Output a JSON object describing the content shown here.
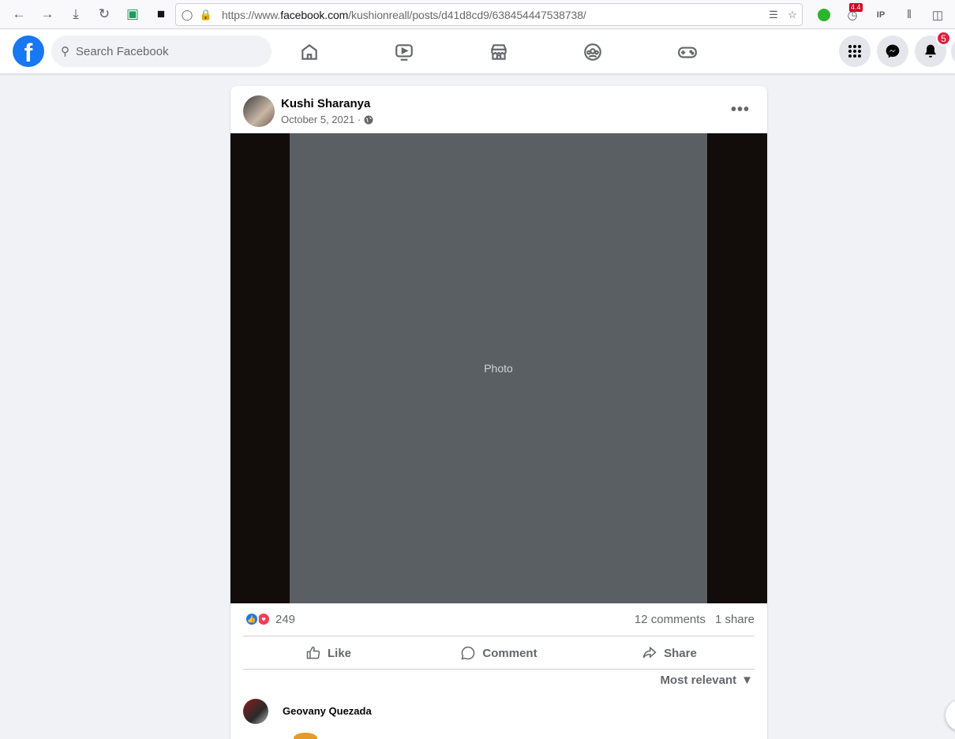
{
  "browser": {
    "url_prefix": "https://www.",
    "url_domain": "facebook.com",
    "url_path": "/kushionreall/posts/d41d8cd9/638454447538738/",
    "ext_badge": "4.4",
    "icons": [
      "back-icon",
      "forward-icon",
      "download-icon",
      "reload-icon",
      "extension-icon",
      "extension-icon",
      "shield-icon",
      "lock-icon",
      "translate-icon",
      "star-icon",
      "library-icon",
      "sidebar-icon"
    ]
  },
  "header": {
    "logo": "f",
    "search_placeholder": "Search Facebook",
    "nav": [
      "home-icon",
      "watch-icon",
      "marketplace-icon",
      "groups-icon",
      "gaming-icon"
    ],
    "notifications_count": "5",
    "brand_color": "#1877f2"
  },
  "post": {
    "author": "Kushi Sharanya",
    "date": "October 5, 2021 ·",
    "more": "•••",
    "image_alt": "Photo",
    "reaction_count": "249",
    "comments": "12 comments",
    "shares": "1 share",
    "actions": {
      "like": "Like",
      "comment": "Comment",
      "share": "Share"
    },
    "sort_label": "Most relevant",
    "comment": {
      "author": "Geovany Quezada"
    }
  }
}
